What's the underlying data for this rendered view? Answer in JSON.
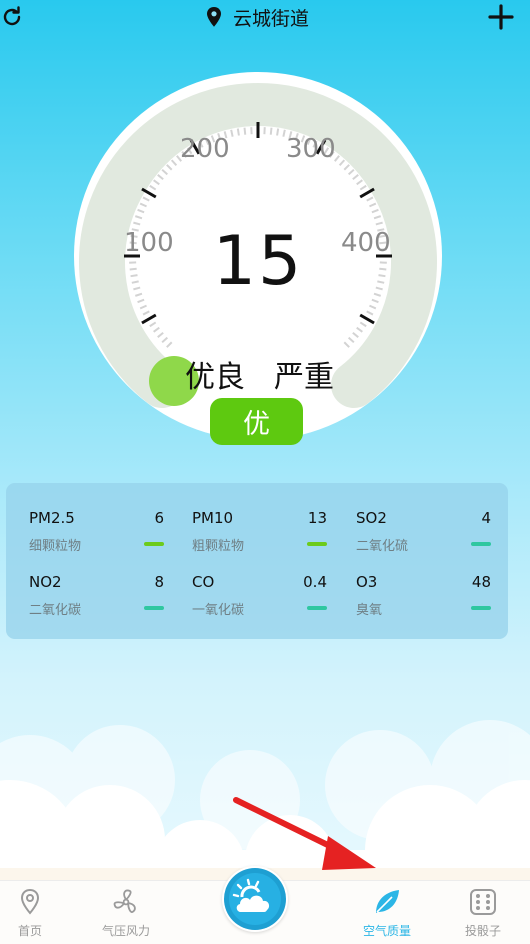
{
  "header": {
    "location": "云城街道",
    "refresh_icon": "refresh-icon",
    "location_icon": "location-pin-icon",
    "add_icon": "plus-icon"
  },
  "gauge": {
    "aqi": "15",
    "scale": [
      "100",
      "200",
      "300",
      "400"
    ],
    "label_good": "优良",
    "label_severe": "严重",
    "level": "优",
    "level_color": "#5ec910",
    "indicator_color": "#8fd84a"
  },
  "pollutants": [
    {
      "name": "PM2.5",
      "value": "6",
      "desc": "细颗粒物",
      "color": "#6ccb1c"
    },
    {
      "name": "PM10",
      "value": "13",
      "desc": "粗颗粒物",
      "color": "#6ccb1c"
    },
    {
      "name": "SO2",
      "value": "4",
      "desc": "二氧化硫",
      "color": "#2fc7a0"
    },
    {
      "name": "NO2",
      "value": "8",
      "desc": "二氧化碳",
      "color": "#2fc7a0"
    },
    {
      "name": "CO",
      "value": "0.4",
      "desc": "一氧化碳",
      "color": "#2fc7a0"
    },
    {
      "name": "O3",
      "value": "48",
      "desc": "臭氧",
      "color": "#2fc7a0"
    }
  ],
  "nav": {
    "items": [
      {
        "label": "首页",
        "icon": "location-pin-icon"
      },
      {
        "label": "气压风力",
        "icon": "fan-icon"
      },
      {
        "label": "空气质量",
        "icon": "leaf-icon",
        "active": true
      },
      {
        "label": "投骰子",
        "icon": "dice-icon"
      }
    ],
    "center_icon": "weather-cloud-sun-icon",
    "accent": "#2cb6e6"
  }
}
